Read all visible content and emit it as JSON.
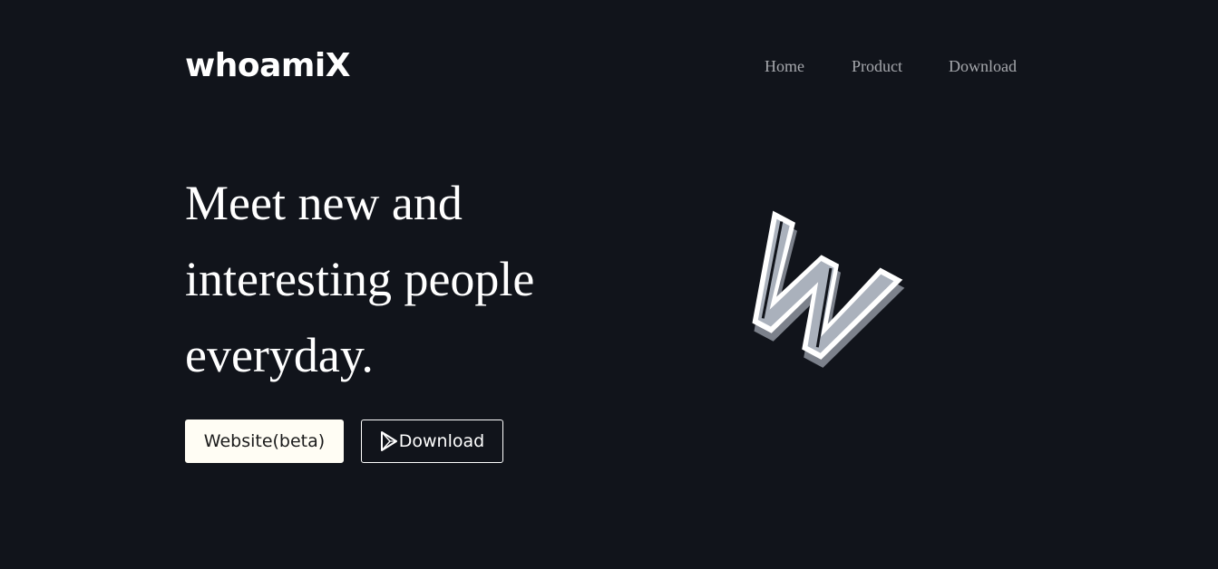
{
  "header": {
    "brand": "whoamiX",
    "nav": [
      {
        "label": "Home"
      },
      {
        "label": "Product"
      },
      {
        "label": "Download"
      }
    ]
  },
  "hero": {
    "title": "Meet new and interesting people everyday.",
    "buttons": {
      "website_label": "Website(beta)",
      "download_label": "Download",
      "download_icon": "play-store-icon"
    },
    "logo_icon": "w-logo-icon"
  },
  "colors": {
    "background": "#11141b",
    "nav_text": "#a6a8ad",
    "primary_button_bg": "#fffdf4",
    "logo_fill": "#aab1bc"
  }
}
